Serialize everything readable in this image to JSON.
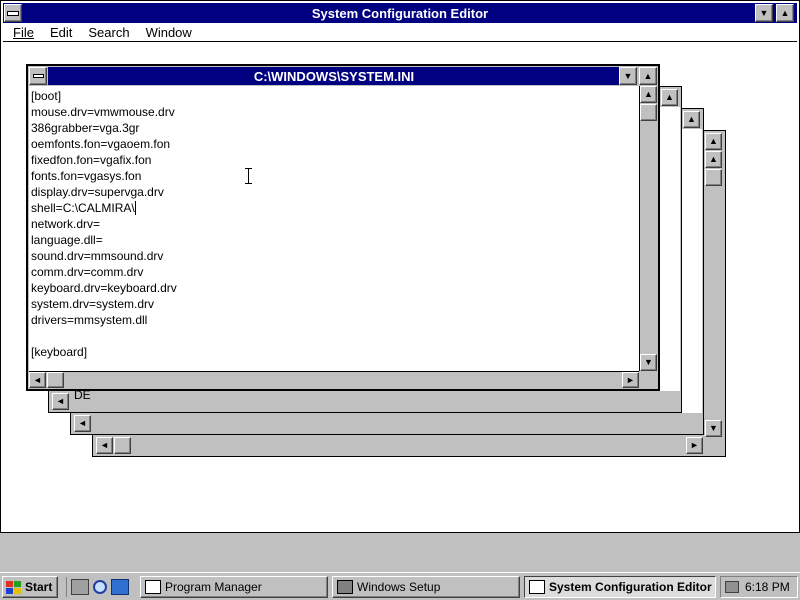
{
  "app": {
    "title": "System Configuration Editor",
    "menu": [
      "File",
      "Edit",
      "Search",
      "Window"
    ]
  },
  "front_window": {
    "title": "C:\\WINDOWS\\SYSTEM.INI",
    "lines": [
      "[boot]",
      "mouse.drv=vmwmouse.drv",
      "386grabber=vga.3gr",
      "oemfonts.fon=vgaoem.fon",
      "fixedfon.fon=vgafix.fon",
      "fonts.fon=vgasys.fon",
      "display.drv=supervga.drv",
      "shell=C:\\CALMIRA\\",
      "network.drv=",
      "language.dll=",
      "sound.drv=mmsound.drv",
      "comm.drv=comm.drv",
      "keyboard.drv=keyboard.drv",
      "system.drv=system.drv",
      "drivers=mmsystem.dll",
      "",
      "[keyboard]"
    ]
  },
  "back_window_snippet": "DE",
  "taskbar": {
    "start_label": "Start",
    "tasks": [
      "Program Manager",
      "Windows Setup",
      "System Configuration Editor"
    ],
    "clock": "6:18 PM"
  },
  "colors": {
    "titlebar": "#000080",
    "face": "#c0c0c0",
    "client": "#ffffff"
  }
}
